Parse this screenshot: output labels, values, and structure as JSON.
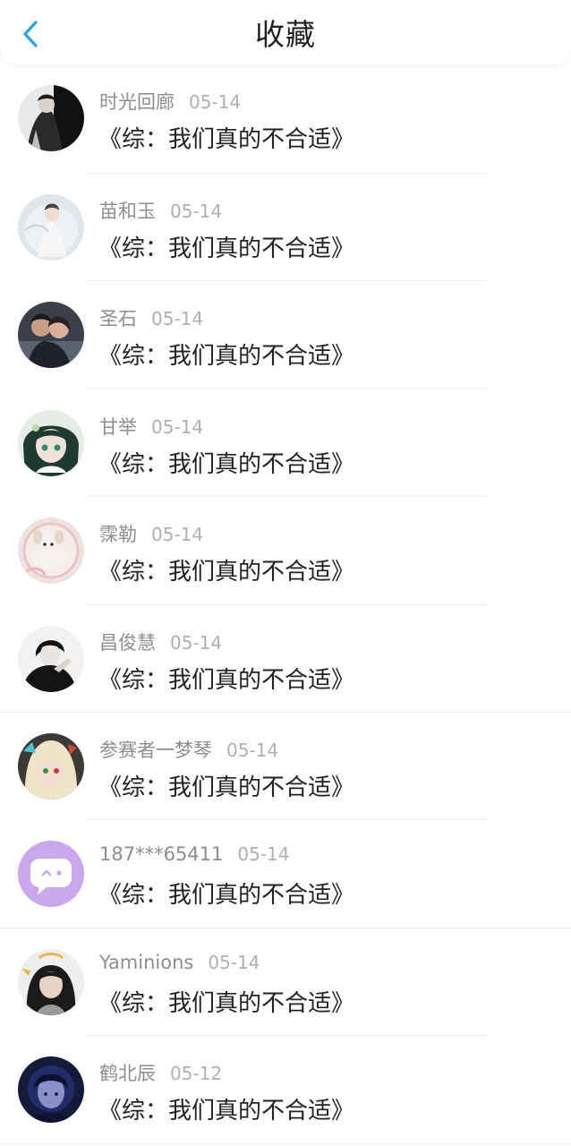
{
  "header": {
    "title": "收藏",
    "back_icon": "chevron-left-icon",
    "accent_color": "#2aa3ef"
  },
  "list": {
    "items": [
      {
        "user": "时光回廊",
        "date": "05-14",
        "book": "《综：我们真的不合适》",
        "avatar": "avatar-dark-figure"
      },
      {
        "user": "苗和玉",
        "date": "05-14",
        "book": "《综：我们真的不合适》",
        "avatar": "avatar-light-figure"
      },
      {
        "user": "圣石",
        "date": "05-14",
        "book": "《综：我们真的不合适》",
        "avatar": "avatar-couple"
      },
      {
        "user": "甘举",
        "date": "05-14",
        "book": "《综：我们真的不合适》",
        "avatar": "avatar-anime-green"
      },
      {
        "user": "霂勒",
        "date": "05-14",
        "book": "《综：我们真的不合适》",
        "avatar": "avatar-cat-pink"
      },
      {
        "user": "昌俊慧",
        "date": "05-14",
        "book": "《综：我们真的不合适》",
        "avatar": "avatar-bw-portrait"
      },
      {
        "user": "参赛者一梦琴",
        "date": "05-14",
        "book": "《综：我们真的不合适》",
        "avatar": "avatar-anime-cream"
      },
      {
        "user": "187***65411",
        "date": "05-14",
        "book": "《综：我们真的不合适》",
        "avatar": "avatar-default-chat"
      },
      {
        "user": "Yaminions",
        "date": "05-14",
        "book": "《综：我们真的不合适》",
        "avatar": "avatar-anime-dark"
      },
      {
        "user": "鹤北辰",
        "date": "05-12",
        "book": "《综：我们真的不合适》",
        "avatar": "avatar-blue-night"
      }
    ]
  }
}
